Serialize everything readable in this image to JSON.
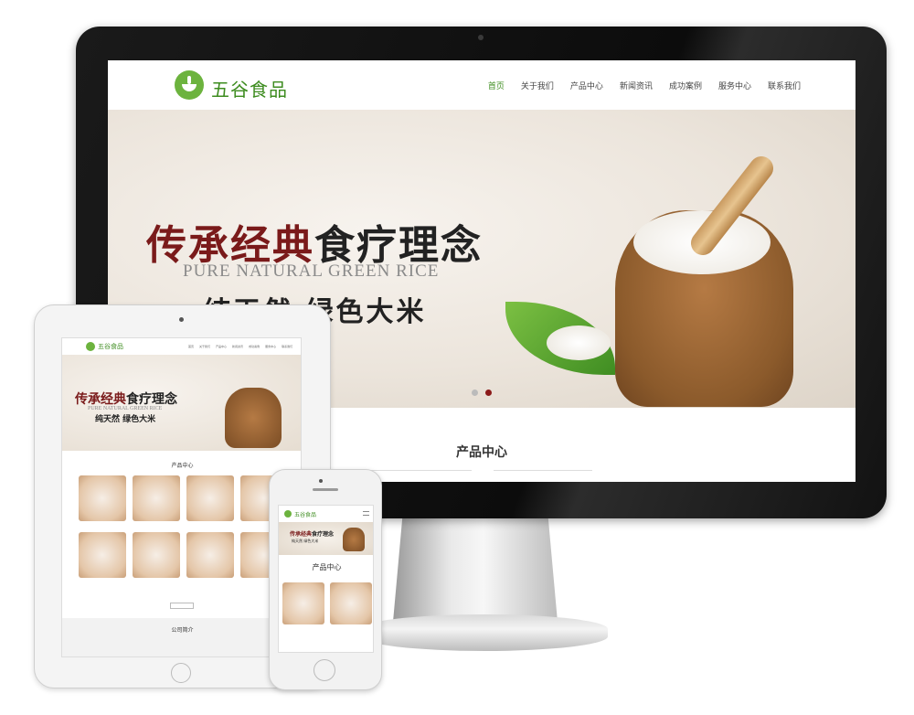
{
  "desktop": {
    "logo_text": "五谷食品",
    "nav": [
      "首页",
      "关于我们",
      "产品中心",
      "新闻资讯",
      "成功案例",
      "服务中心",
      "联系我们"
    ],
    "banner": {
      "title_red": "传承经典",
      "title_dark": "食疗理念",
      "subtitle_en": "PURE NATURAL GREEN RICE",
      "subtitle_cn": "纯天然  绿色大米"
    },
    "section_title": "产品中心"
  },
  "tablet": {
    "logo_text": "五谷食品",
    "banner": {
      "title_red": "传承经典",
      "title_dark": "食疗理念",
      "subtitle_en": "PURE NATURAL GREEN RICE",
      "subtitle_cn": "纯天然  绿色大米"
    },
    "section_title": "产品中心",
    "about_title": "公司简介"
  },
  "phone": {
    "logo_text": "五谷食品",
    "banner": {
      "title_red": "传承经典",
      "title_dark": "食疗理念",
      "subtitle_cn": "纯天然  绿色大米"
    },
    "section_title": "产品中心"
  },
  "colors": {
    "brand_green": "#6cb33e",
    "title_red": "#7a1a1a",
    "active_dot": "#8b1a1a"
  }
}
